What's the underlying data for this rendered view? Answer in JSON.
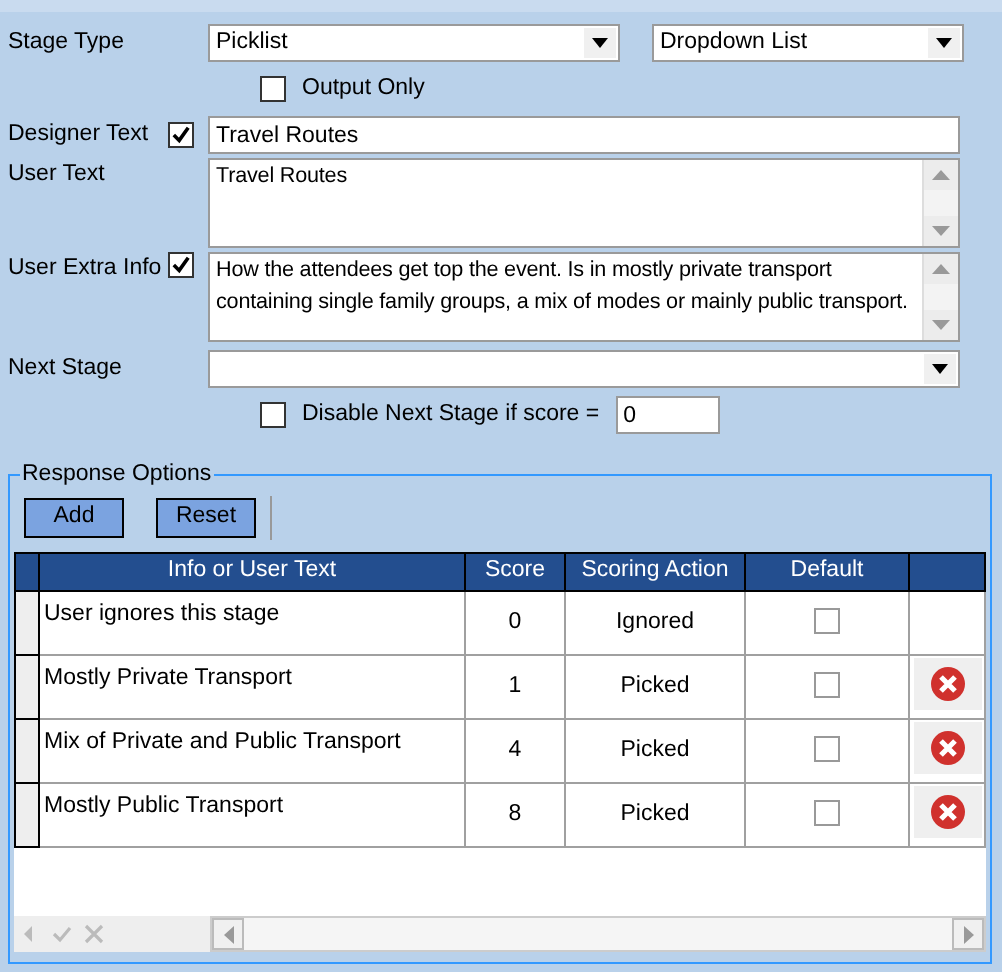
{
  "stage_type": {
    "label": "Stage Type",
    "value": "Picklist",
    "display": "Dropdown List"
  },
  "output_only": {
    "label": "Output Only",
    "checked": false
  },
  "designer_text": {
    "label": "Designer Text",
    "checked": true,
    "value": "Travel Routes"
  },
  "user_text": {
    "label": "User Text",
    "value": "Travel Routes"
  },
  "user_extra_info": {
    "label": "User Extra Info",
    "checked": true,
    "value": "How the attendees get top the event. Is in mostly private transport containing single family groups, a mix of modes or mainly public transport."
  },
  "next_stage": {
    "label": "Next Stage"
  },
  "disable_next_stage": {
    "label": "Disable Next Stage if score =",
    "checked": false,
    "value": "0"
  },
  "response_options": {
    "title": "Response Options",
    "buttons": [
      "Add",
      "Reset"
    ],
    "columns": [
      "Info or User Text",
      "Score",
      "Scoring Action",
      "Default"
    ],
    "rows": [
      {
        "text": "User ignores this stage",
        "score": "0",
        "action": "Ignored",
        "default": false,
        "deletable": false
      },
      {
        "text": "Mostly Private Transport",
        "score": "1",
        "action": "Picked",
        "default": false,
        "deletable": true
      },
      {
        "text": "Mix of Private and Public Transport",
        "score": "4",
        "action": "Picked",
        "default": false,
        "deletable": true
      },
      {
        "text": "Mostly Public Transport",
        "score": "8",
        "action": "Picked",
        "default": false,
        "deletable": true
      }
    ]
  }
}
